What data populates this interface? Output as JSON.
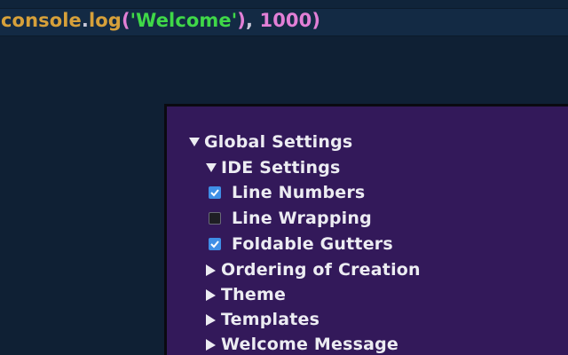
{
  "editor": {
    "code_line": {
      "fn": "console",
      "dot": ".",
      "method": "log",
      "open_paren": "(",
      "string": "'Welcome'",
      "close_paren": ")",
      "comma": ",",
      "number": "1000",
      "close_paren_2": ")"
    }
  },
  "settings_tree": {
    "global": {
      "label": "Global Settings",
      "expanded": true
    },
    "ide": {
      "label": "IDE Settings",
      "expanded": true
    },
    "options": [
      {
        "label": "Line Numbers",
        "checked": true
      },
      {
        "label": "Line Wrapping",
        "checked": false
      },
      {
        "label": "Foldable Gutters",
        "checked": true
      }
    ],
    "sections": [
      {
        "label": "Ordering of Creation",
        "expanded": false
      },
      {
        "label": "Theme",
        "expanded": false
      },
      {
        "label": "Templates",
        "expanded": false
      },
      {
        "label": "Welcome Message",
        "expanded": false
      }
    ]
  },
  "colors": {
    "editor_bg": "#0f2034",
    "panel_bg": "#33195a",
    "checkbox_on": "#3f8fe6",
    "string": "#3fd848",
    "function": "#d6a03a",
    "number": "#e27fd6"
  },
  "icons": {
    "expanded": "triangle-down-icon",
    "collapsed": "triangle-right-icon",
    "checked": "checkbox-checked-icon",
    "unchecked": "checkbox-unchecked-icon"
  }
}
